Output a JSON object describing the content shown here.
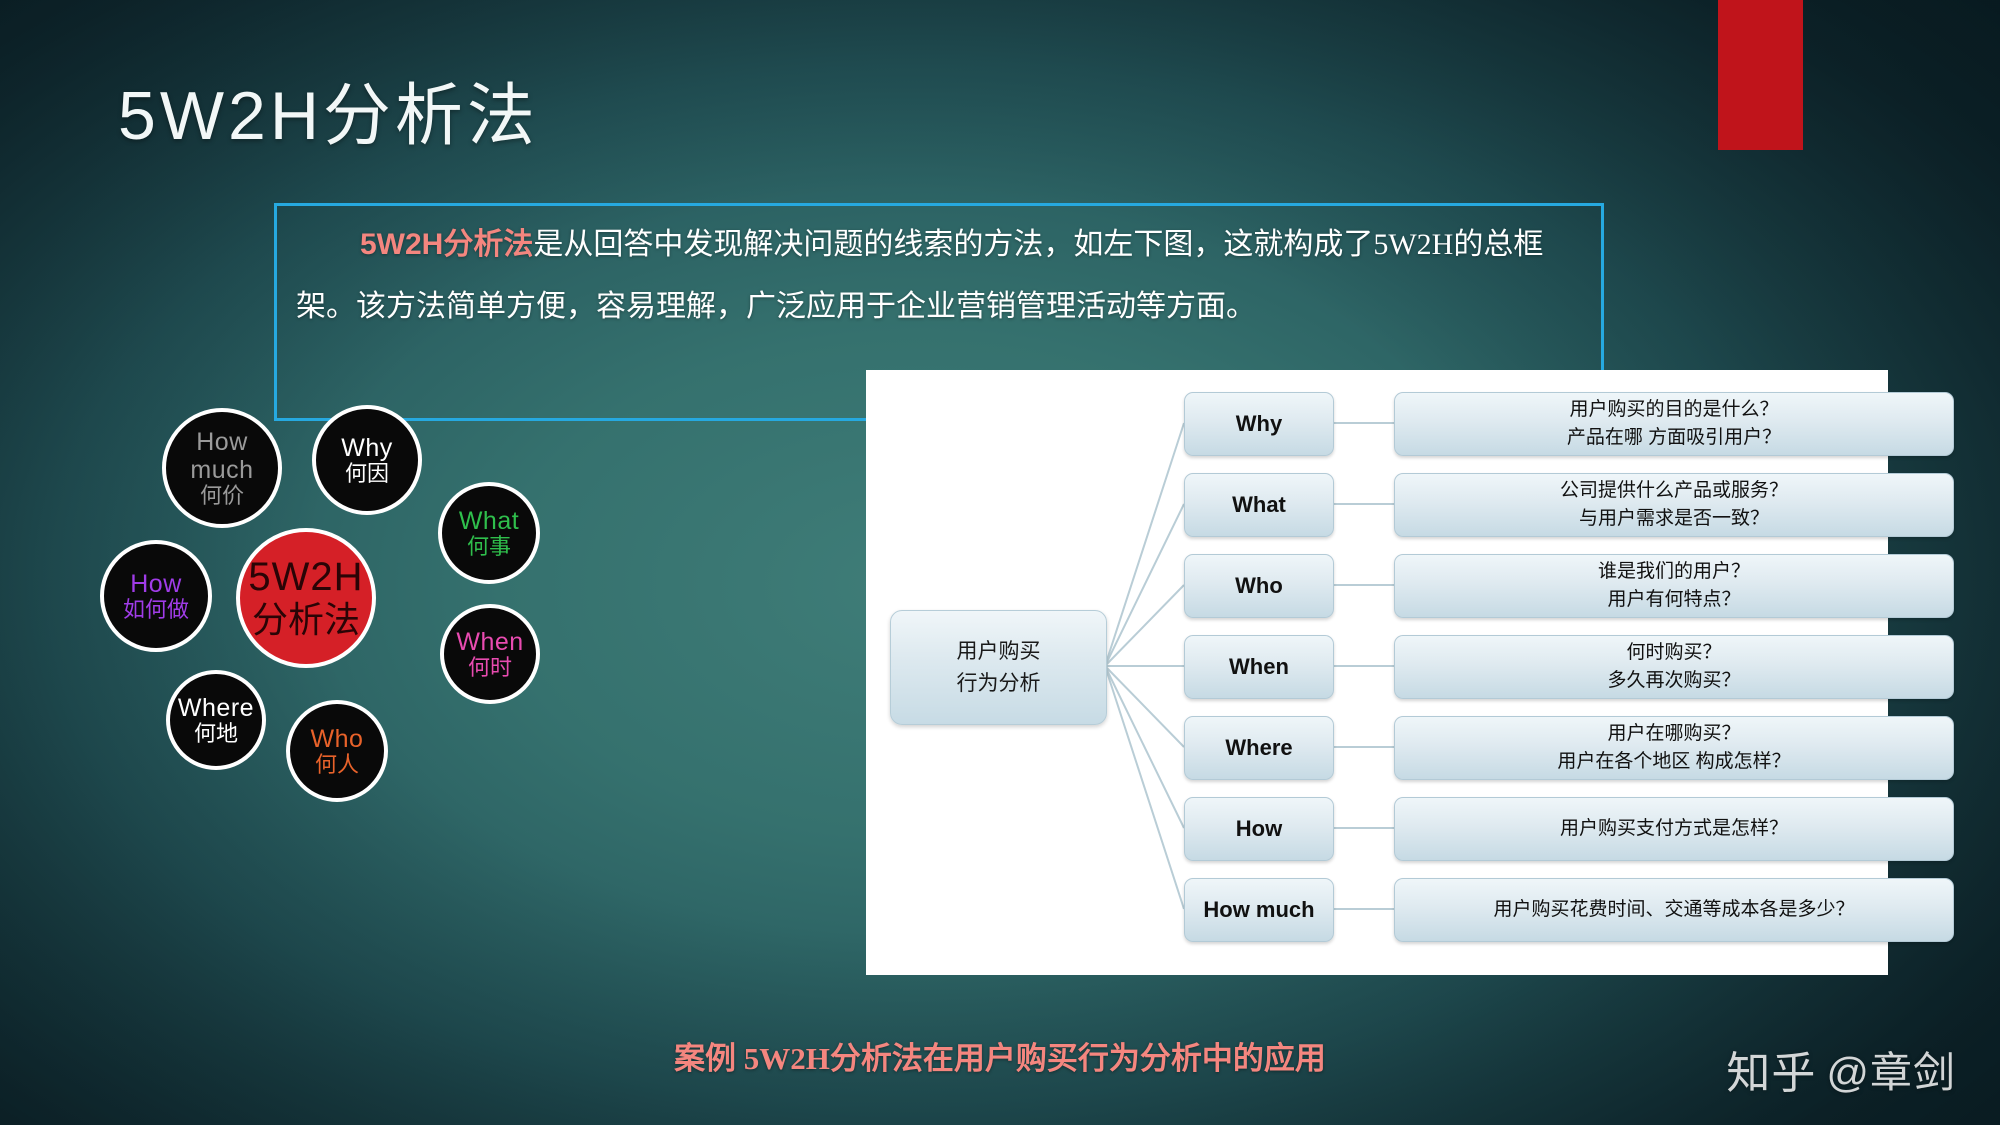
{
  "slide": {
    "title": "5W2H分析法",
    "accent_red": "#c0141b",
    "accent_pink": "#f4867f",
    "border_blue": "#26a9e0",
    "background": "#35716e"
  },
  "description": {
    "highlight": "5W2H分析法",
    "body": "是从回答中发现解决问题的线索的方法，如左下图，这就构成了5W2H的总框架。该方法简单方便，容易理解，广泛应用于企业营销管理活动等方面。"
  },
  "circle_diagram": {
    "center": {
      "en": "5W2H",
      "cn": "分析法",
      "color": "#2a0406",
      "fill": "#d52027"
    },
    "nodes": [
      {
        "en": "How much",
        "cn": "何价",
        "color": "#9a9a9a"
      },
      {
        "en": "Why",
        "cn": "何因",
        "color": "#ffffff"
      },
      {
        "en": "What",
        "cn": "何事",
        "color": "#2fbf4c"
      },
      {
        "en": "How",
        "cn": "如何做",
        "color": "#a03ce8"
      },
      {
        "en": "When",
        "cn": "何时",
        "color": "#e84bb0"
      },
      {
        "en": "Where",
        "cn": "何地",
        "color": "#ffffff"
      },
      {
        "en": "Who",
        "cn": "何人",
        "color": "#e8622a"
      }
    ]
  },
  "flowchart": {
    "root": {
      "line1": "用户购买",
      "line2": "行为分析"
    },
    "rows": [
      {
        "key": "Why",
        "answer": [
          "用户购买的目的是什么？",
          "产品在哪 方面吸引用户？"
        ]
      },
      {
        "key": "What",
        "answer": [
          "公司提供什么产品或服务？",
          "与用户需求是否一致？"
        ]
      },
      {
        "key": "Who",
        "answer": [
          "谁是我们的用户？",
          "用户有何特点？"
        ]
      },
      {
        "key": "When",
        "answer": [
          "何时购买？",
          "多久再次购买？"
        ]
      },
      {
        "key": "Where",
        "answer": [
          "用户在哪购买？",
          "用户在各个地区 构成怎样？"
        ]
      },
      {
        "key": "How",
        "answer": [
          "用户购买支付方式是怎样？"
        ]
      },
      {
        "key": "How much",
        "answer": [
          "用户购买花费时间、交通等成本各是多少？"
        ]
      }
    ]
  },
  "caption": "案例  5W2H分析法在用户购买行为分析中的应用",
  "watermark": {
    "logo": "知乎",
    "user": "@章剑"
  }
}
